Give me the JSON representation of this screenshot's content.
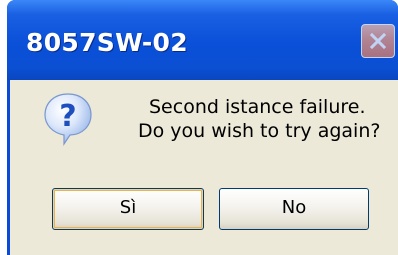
{
  "window": {
    "title": "8057SW-02"
  },
  "message": {
    "line1": "Second istance failure.",
    "line2": "Do you wish to try again?"
  },
  "buttons": {
    "yes_label": "Sì",
    "no_label": "No"
  },
  "icons": {
    "dialog_icon": "question-icon",
    "close": "close-icon"
  },
  "colors": {
    "titlebar": "#0a50d8",
    "dialog_bg": "#ece9d8",
    "button_border": "#003c74",
    "focus_ring": "#e8b25a"
  }
}
